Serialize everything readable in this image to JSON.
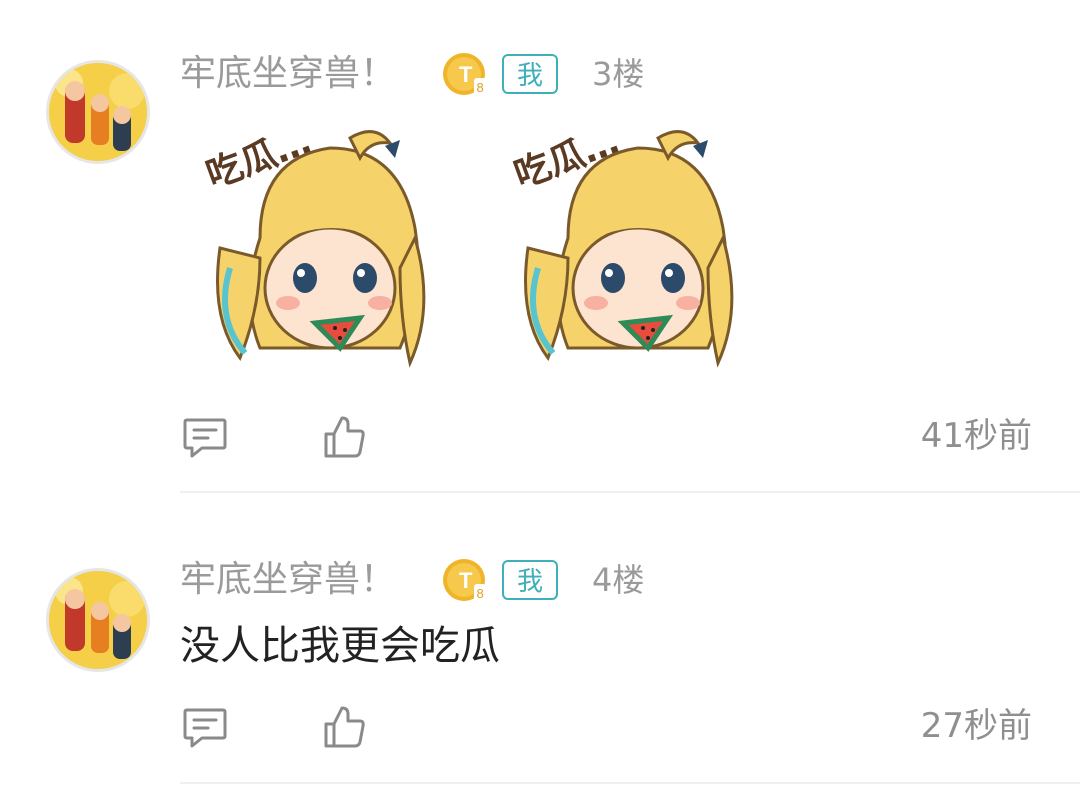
{
  "posts": [
    {
      "username": "牢底坐穿兽！",
      "level_badge": {
        "text": "T",
        "sub": "8",
        "color": "#f0b429"
      },
      "me_badge": "我",
      "floor": "3楼",
      "stickers": [
        {
          "text": "吃瓜…",
          "icon": "sticker-girl-eating-watermelon"
        },
        {
          "text": "吃瓜…",
          "icon": "sticker-girl-eating-watermelon"
        }
      ],
      "time": "41秒前",
      "icons": {
        "comment": "comment-icon",
        "like": "thumbs-up-icon"
      }
    },
    {
      "username": "牢底坐穿兽！",
      "level_badge": {
        "text": "T",
        "sub": "8",
        "color": "#f0b429"
      },
      "me_badge": "我",
      "floor": "4楼",
      "content": "没人比我更会吃瓜",
      "time": "27秒前",
      "icons": {
        "comment": "comment-icon",
        "like": "thumbs-up-icon"
      }
    }
  ],
  "colors": {
    "accent": "#3fb0b8",
    "meta_text": "#9a9a9a",
    "body_text": "#222222",
    "divider": "#efefef"
  }
}
